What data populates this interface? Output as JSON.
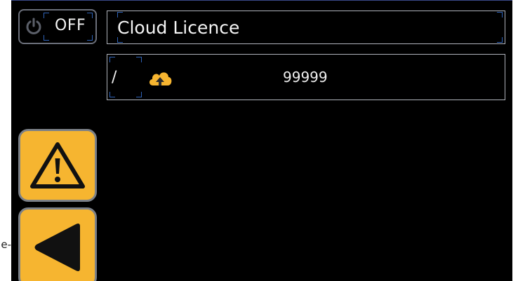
{
  "stray_text": "e-",
  "power": {
    "label": "OFF",
    "icon": "power-icon"
  },
  "title": {
    "text": "Cloud Licence"
  },
  "licence_row": {
    "prefix": "/",
    "icon": "cloud-upload-icon",
    "value": "99999"
  },
  "side_buttons": {
    "warning_icon": "warning-icon",
    "back_icon": "back-arrow-icon"
  },
  "colors": {
    "background": "#000000",
    "accent": "#f6b530",
    "frame": "#b0b4bc",
    "selector": "#2f63b8"
  }
}
